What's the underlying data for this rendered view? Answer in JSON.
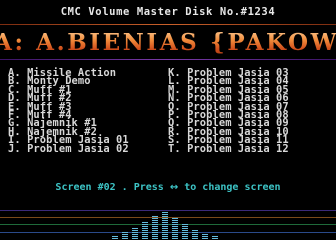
{
  "header": {
    "title": "CMC Volume Master Disk No.#1234"
  },
  "scroller": {
    "text": "A: A.BIENIAS {PAKOWANI"
  },
  "menu": {
    "left": [
      "A. Missile Action",
      "B. Monty Demo",
      "C. Muff #1",
      "D. Muff #2",
      "E. Muff #3",
      "F. Muff #4",
      "G. Najemnik #1",
      "H. Najemnik #2",
      "I. Problem Jasia 01",
      "J. Problem Jasia 02"
    ],
    "right": [
      "K. Problem Jasia 03",
      "L. Problem Jasia 04",
      "M. Problem Jasia 05",
      "N. Problem Jasia 06",
      "O. Problem Jasia 07",
      "P. Problem Jasia 08",
      "Q. Problem Jasia 09",
      "R. Problem Jasia 10",
      "S. Problem Jasia 11",
      "T. Problem Jasia 12"
    ]
  },
  "status": {
    "screen": "Screen #02",
    "press": " . Press ",
    "arrows": "↔",
    "action": " to change screen"
  },
  "colors": {
    "background": "#000000",
    "menu_text": "#d8d8d8",
    "status_text": "#3dc4c6",
    "scroller_gradient": [
      "#ffd09a",
      "#f08a3a",
      "#d2501c",
      "#a33a10"
    ],
    "analyzer_gradient": [
      "#1d4fd0",
      "#2aa0d8",
      "#7ad8d8",
      "#ffffff"
    ]
  }
}
